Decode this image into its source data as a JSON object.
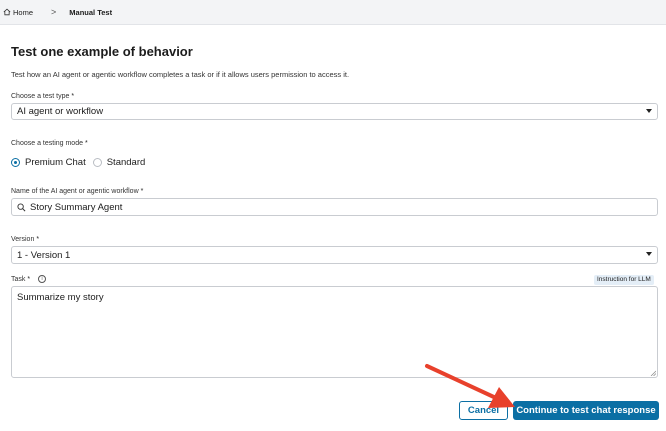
{
  "breadcrumb": {
    "home": "Home",
    "separator": ">",
    "current": "Manual Test"
  },
  "page": {
    "title": "Test one example of behavior",
    "subtitle": "Test how an AI agent or agentic workflow completes a task or if it allows users permission to access it."
  },
  "test_type": {
    "label": "Choose a test type",
    "required": "*",
    "value": "AI agent or workflow"
  },
  "testing_mode": {
    "label": "Choose a testing mode",
    "required": "*",
    "options": [
      "Premium Chat",
      "Standard"
    ],
    "selected": "Premium Chat"
  },
  "agent_name": {
    "label": "Name of the AI agent or agentic workflow",
    "required": "*",
    "value": "Story Summary Agent"
  },
  "version": {
    "label": "Version",
    "required": "*",
    "value": "1 - Version 1"
  },
  "task": {
    "label": "Task",
    "required": "*",
    "info": "i",
    "badge": "Instruction for LLM",
    "value": "Summarize my story"
  },
  "actions": {
    "cancel": "Cancel",
    "continue": "Continue to test chat response"
  },
  "colors": {
    "accent": "#0b6fa4",
    "annotation_arrow": "#e8412c",
    "topbar_bg": "#f3f4f6"
  },
  "icons": {
    "home": "home-icon",
    "search": "search-icon",
    "caret": "chevron-down-icon",
    "info": "info-icon"
  }
}
